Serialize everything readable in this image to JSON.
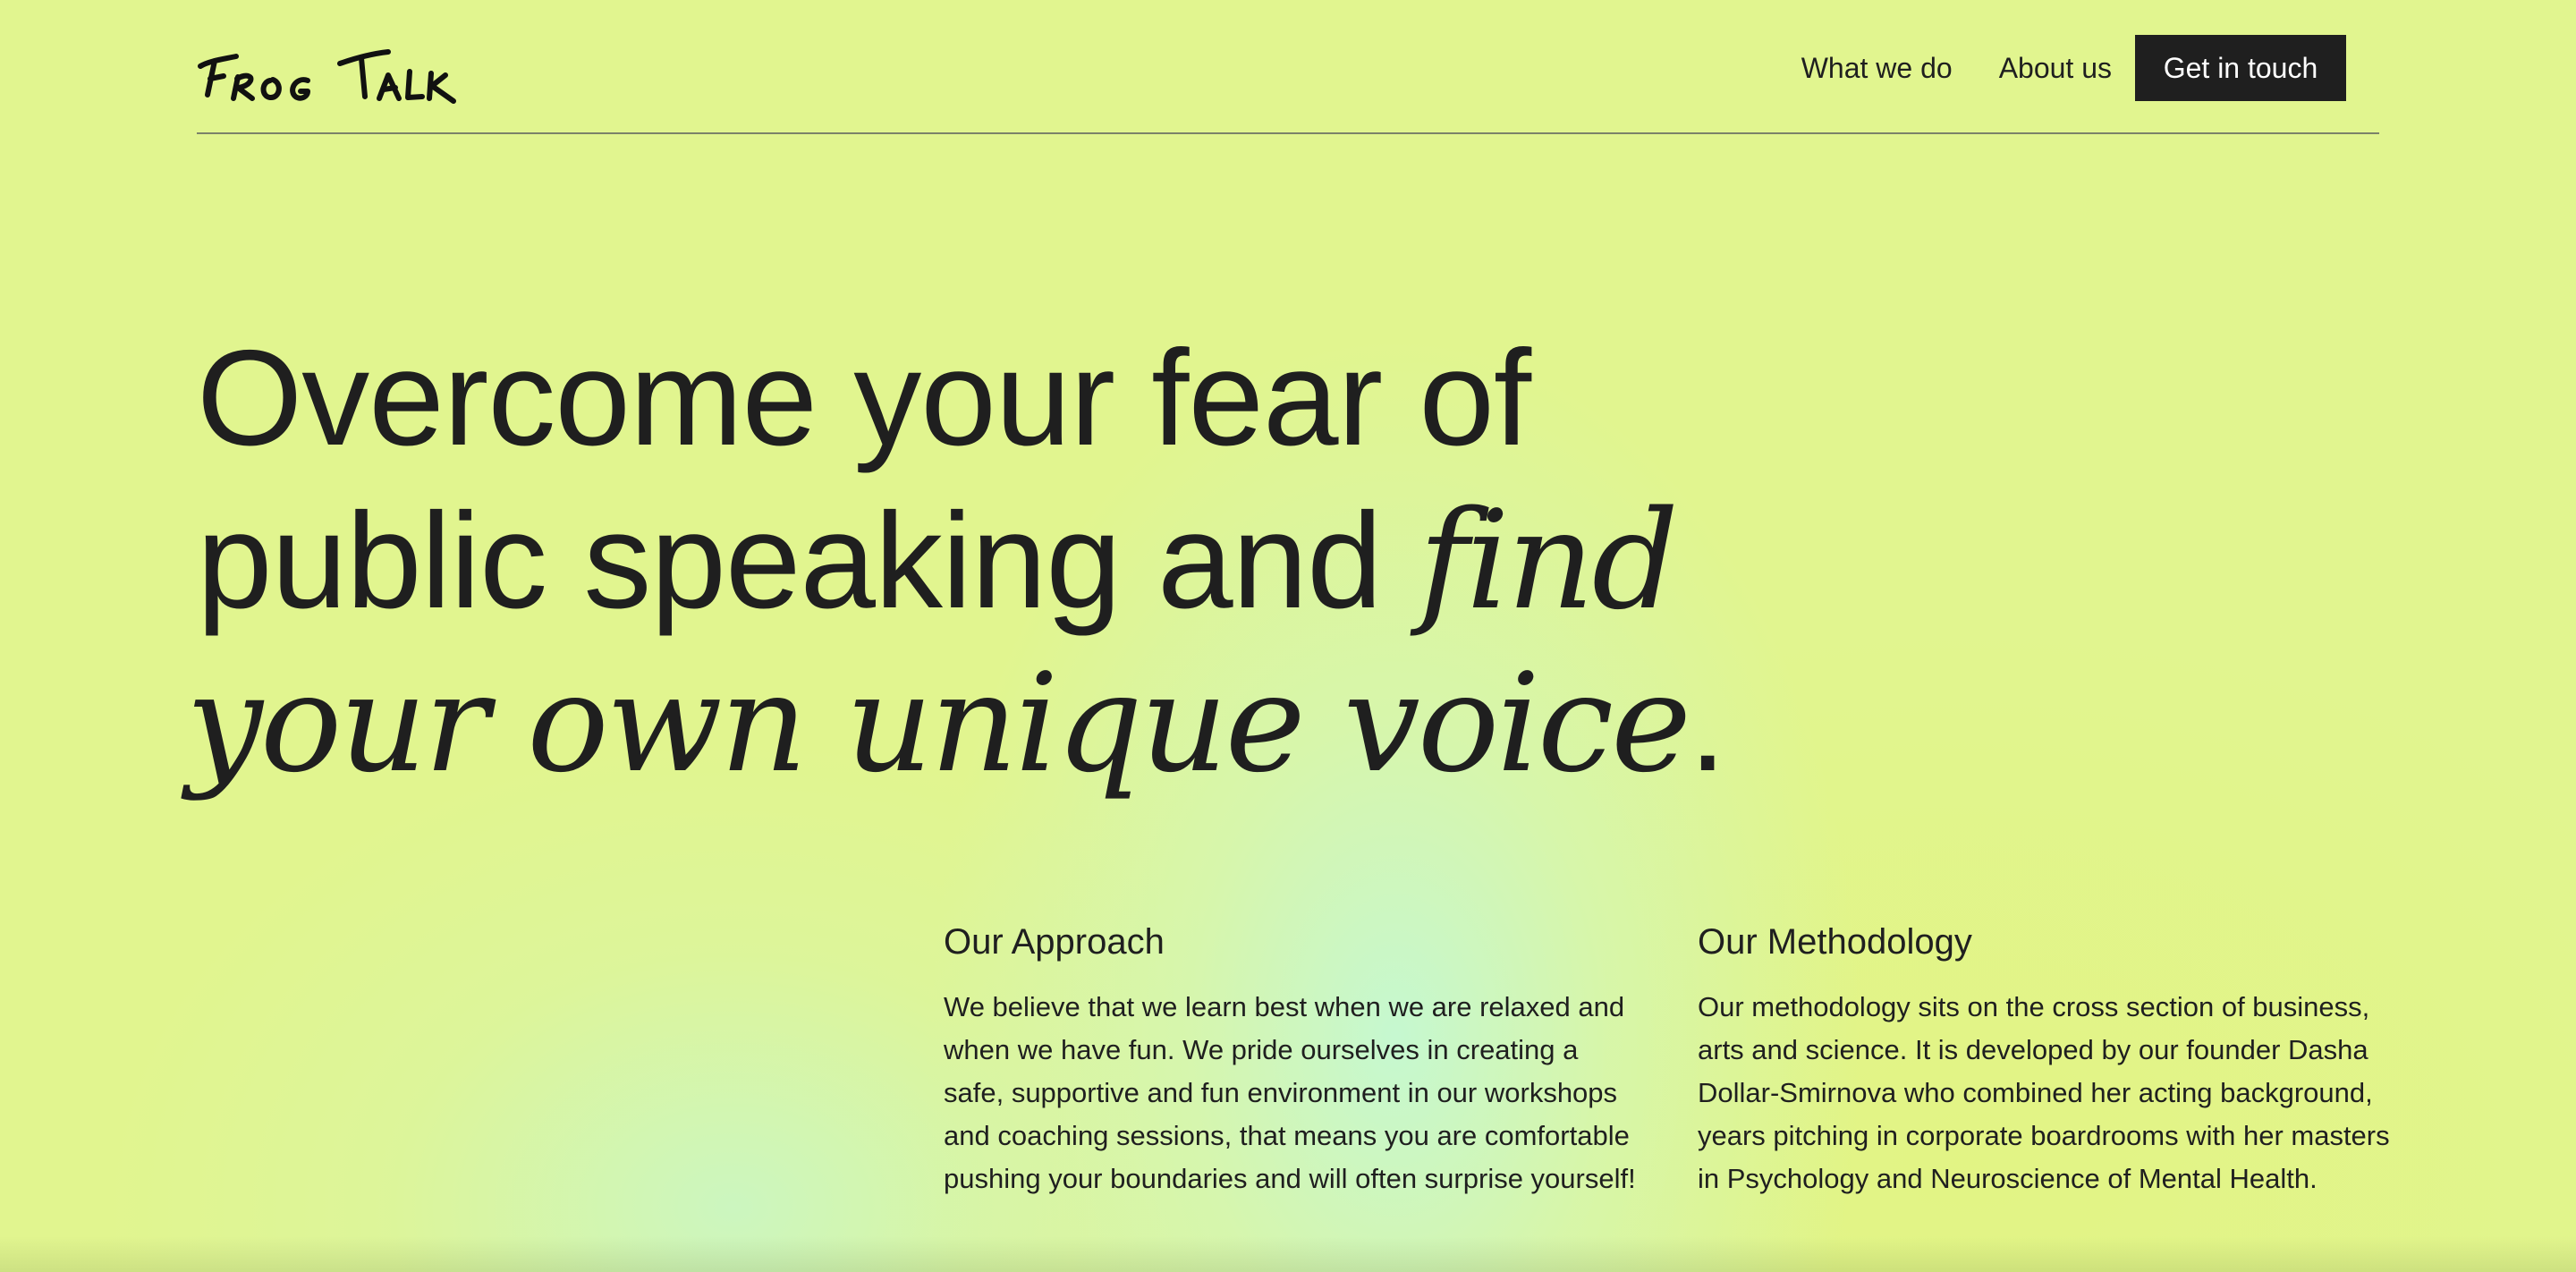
{
  "header": {
    "logo_text": "Frog Talk",
    "logo_icon": "handwritten-wordmark",
    "nav": [
      {
        "label": "What we do"
      },
      {
        "label": "About us"
      }
    ],
    "cta_label": "Get in touch"
  },
  "hero": {
    "line1": "Overcome your fear of",
    "line2_plain": "public speaking and ",
    "line2_italic": "find",
    "line3_italic": "your own unique voice",
    "line3_end": "."
  },
  "approach": {
    "title": "Our Approach",
    "body": "We believe that we learn best when we are relaxed and when we have fun. We pride ourselves in creating a safe, supportive and fun environment in our workshops and coaching sessions, that means you are comfortable pushing your boundaries and will often surprise yourself!"
  },
  "methodology": {
    "title": "Our Methodology",
    "body": "Our methodology sits on the cross section of business, arts and science. It is developed by our founder Dasha Dollar-Smirnova who combined her acting background, years pitching in corporate boardrooms with her masters in Psychology and Neuroscience of Mental Health."
  },
  "colors": {
    "background": "#e1f58f",
    "text": "#1f1f1f",
    "cta_background": "#1f1f1f",
    "cta_text": "#ffffff",
    "rule": "#7b8269"
  }
}
